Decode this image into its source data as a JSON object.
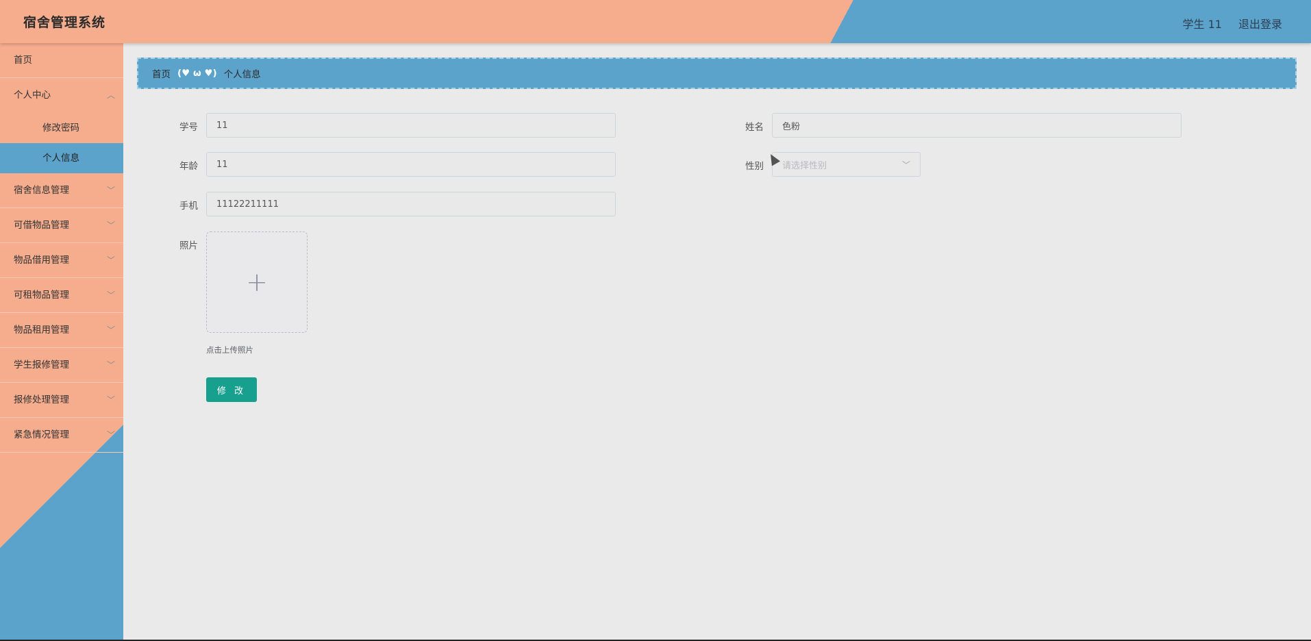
{
  "app": {
    "title": "宿舍管理系统"
  },
  "header": {
    "user": "学生 11",
    "logout": "退出登录"
  },
  "sidebar": {
    "home": "首页",
    "personal_center": {
      "label": "个人中心",
      "children": [
        "修改密码",
        "个人信息"
      ]
    },
    "items": [
      "宿舍信息管理",
      "可借物品管理",
      "物品借用管理",
      "可租物品管理",
      "物品租用管理",
      "学生报修管理",
      "报修处理管理",
      "紧急情况管理"
    ]
  },
  "breadcrumb": {
    "home": "首页",
    "separator": "(♥ ω ♥)",
    "current": "个人信息"
  },
  "form": {
    "student_id": {
      "label": "学号",
      "value": "11"
    },
    "name": {
      "label": "姓名",
      "value": "色粉"
    },
    "age": {
      "label": "年龄",
      "value": "11"
    },
    "gender": {
      "label": "性别",
      "placeholder": "请选择性别"
    },
    "phone": {
      "label": "手机",
      "value": "11122211111"
    },
    "photo": {
      "label": "照片",
      "tip": "点击上传照片"
    },
    "submit_label": "修 改"
  },
  "colors": {
    "header_salmon": "#f5ad8e",
    "header_blue": "#5ca3cc",
    "submit_green": "#17a08e",
    "content_bg": "#eaeaea"
  }
}
